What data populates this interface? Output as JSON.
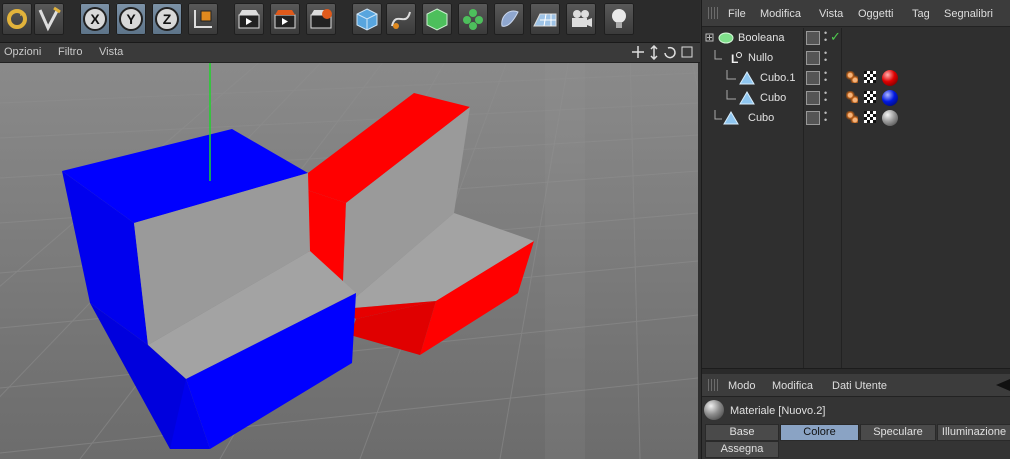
{
  "toolbar": {
    "axis_x": "X",
    "axis_y": "Y",
    "axis_z": "Z"
  },
  "viewport_menu": {
    "items": [
      "Opzioni",
      "Filtro",
      "Vista"
    ]
  },
  "object_manager": {
    "menu": [
      "File",
      "Modifica",
      "Vista",
      "Oggetti",
      "Tag",
      "Segnalibri"
    ],
    "objects": [
      {
        "name": "Booleana"
      },
      {
        "name": "Nullo"
      },
      {
        "name": "Cubo.1"
      },
      {
        "name": "Cubo"
      },
      {
        "name": "Cubo"
      }
    ],
    "checkmark": "✓"
  },
  "attribute_manager": {
    "menu": [
      "Modo",
      "Modifica",
      "Dati Utente"
    ],
    "title": "Materiale [Nuovo.2]",
    "tabs": [
      "Base",
      "Colore",
      "Speculare",
      "Illuminazione"
    ],
    "active_tab": "Colore",
    "assign_tab": "Assegna"
  },
  "colors": {
    "accent_blue": "#0000ff",
    "accent_red": "#ff0000",
    "active_tab": "#8aa3c4"
  }
}
